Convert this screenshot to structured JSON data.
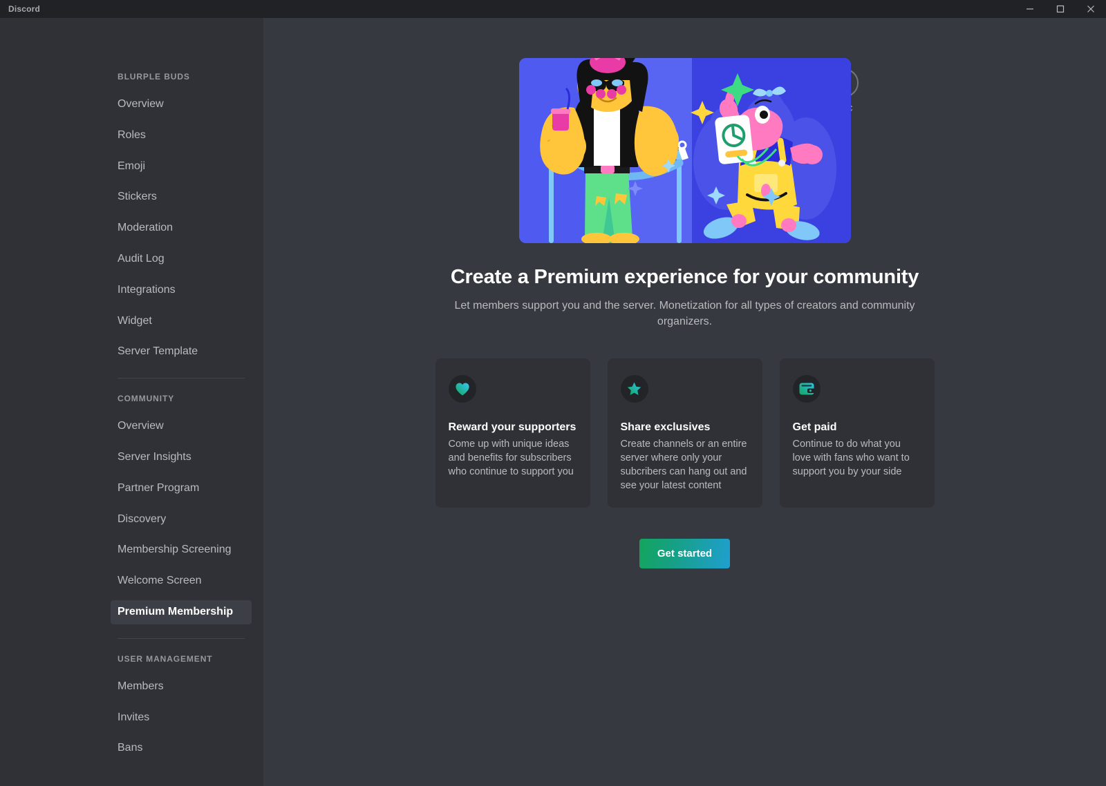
{
  "window": {
    "title": "Discord",
    "controls": [
      {
        "name": "minimize",
        "glyph": "minimize-icon"
      },
      {
        "name": "maximize",
        "glyph": "maximize-icon"
      },
      {
        "name": "close",
        "glyph": "close-icon"
      }
    ]
  },
  "sidebar": {
    "sections": [
      {
        "header": "BLURPLE BUDS",
        "items": [
          {
            "label": "Overview",
            "active": false
          },
          {
            "label": "Roles",
            "active": false
          },
          {
            "label": "Emoji",
            "active": false
          },
          {
            "label": "Stickers",
            "active": false
          },
          {
            "label": "Moderation",
            "active": false
          },
          {
            "label": "Audit Log",
            "active": false
          },
          {
            "label": "Integrations",
            "active": false
          },
          {
            "label": "Widget",
            "active": false
          },
          {
            "label": "Server Template",
            "active": false
          }
        ]
      },
      {
        "header": "COMMUNITY",
        "items": [
          {
            "label": "Overview",
            "active": false
          },
          {
            "label": "Server Insights",
            "active": false
          },
          {
            "label": "Partner Program",
            "active": false
          },
          {
            "label": "Discovery",
            "active": false
          },
          {
            "label": "Membership Screening",
            "active": false
          },
          {
            "label": "Welcome Screen",
            "active": false
          },
          {
            "label": "Premium Membership",
            "active": true
          }
        ]
      },
      {
        "header": "USER MANAGEMENT",
        "items": [
          {
            "label": "Members",
            "active": false
          },
          {
            "label": "Invites",
            "active": false
          },
          {
            "label": "Bans",
            "active": false
          }
        ]
      }
    ]
  },
  "close_control": {
    "icon": "close-icon",
    "label": "ESC"
  },
  "hero": {
    "illustration_name": "premium-membership-hero-illustration",
    "background_color": "#5864f2"
  },
  "main": {
    "title": "Create a Premium experience for your community",
    "subtitle": "Let members support you and the server. Monetization for all types of creators and community organizers.",
    "cards": [
      {
        "icon": "heart-icon",
        "title": "Reward your supporters",
        "description": "Come up with unique ideas and benefits for subscribers who continue to support you"
      },
      {
        "icon": "star-icon",
        "title": "Share exclusives",
        "description": "Create channels or an entire server where only your subcribers can hang out and see your latest content"
      },
      {
        "icon": "wallet-icon",
        "title": "Get paid",
        "description": "Continue to do what you love with fans who want to support you by your side"
      }
    ],
    "cta_label": "Get started"
  },
  "colors": {
    "app_background": "#36393f",
    "sidebar_background": "#2f3136",
    "titlebar_background": "#202225",
    "card_background": "#2f3136",
    "accent_gradient_start": "#13a55c",
    "accent_gradient_end": "#1f9fd0",
    "text_primary": "#ffffff",
    "text_muted": "#b9bbbe"
  }
}
